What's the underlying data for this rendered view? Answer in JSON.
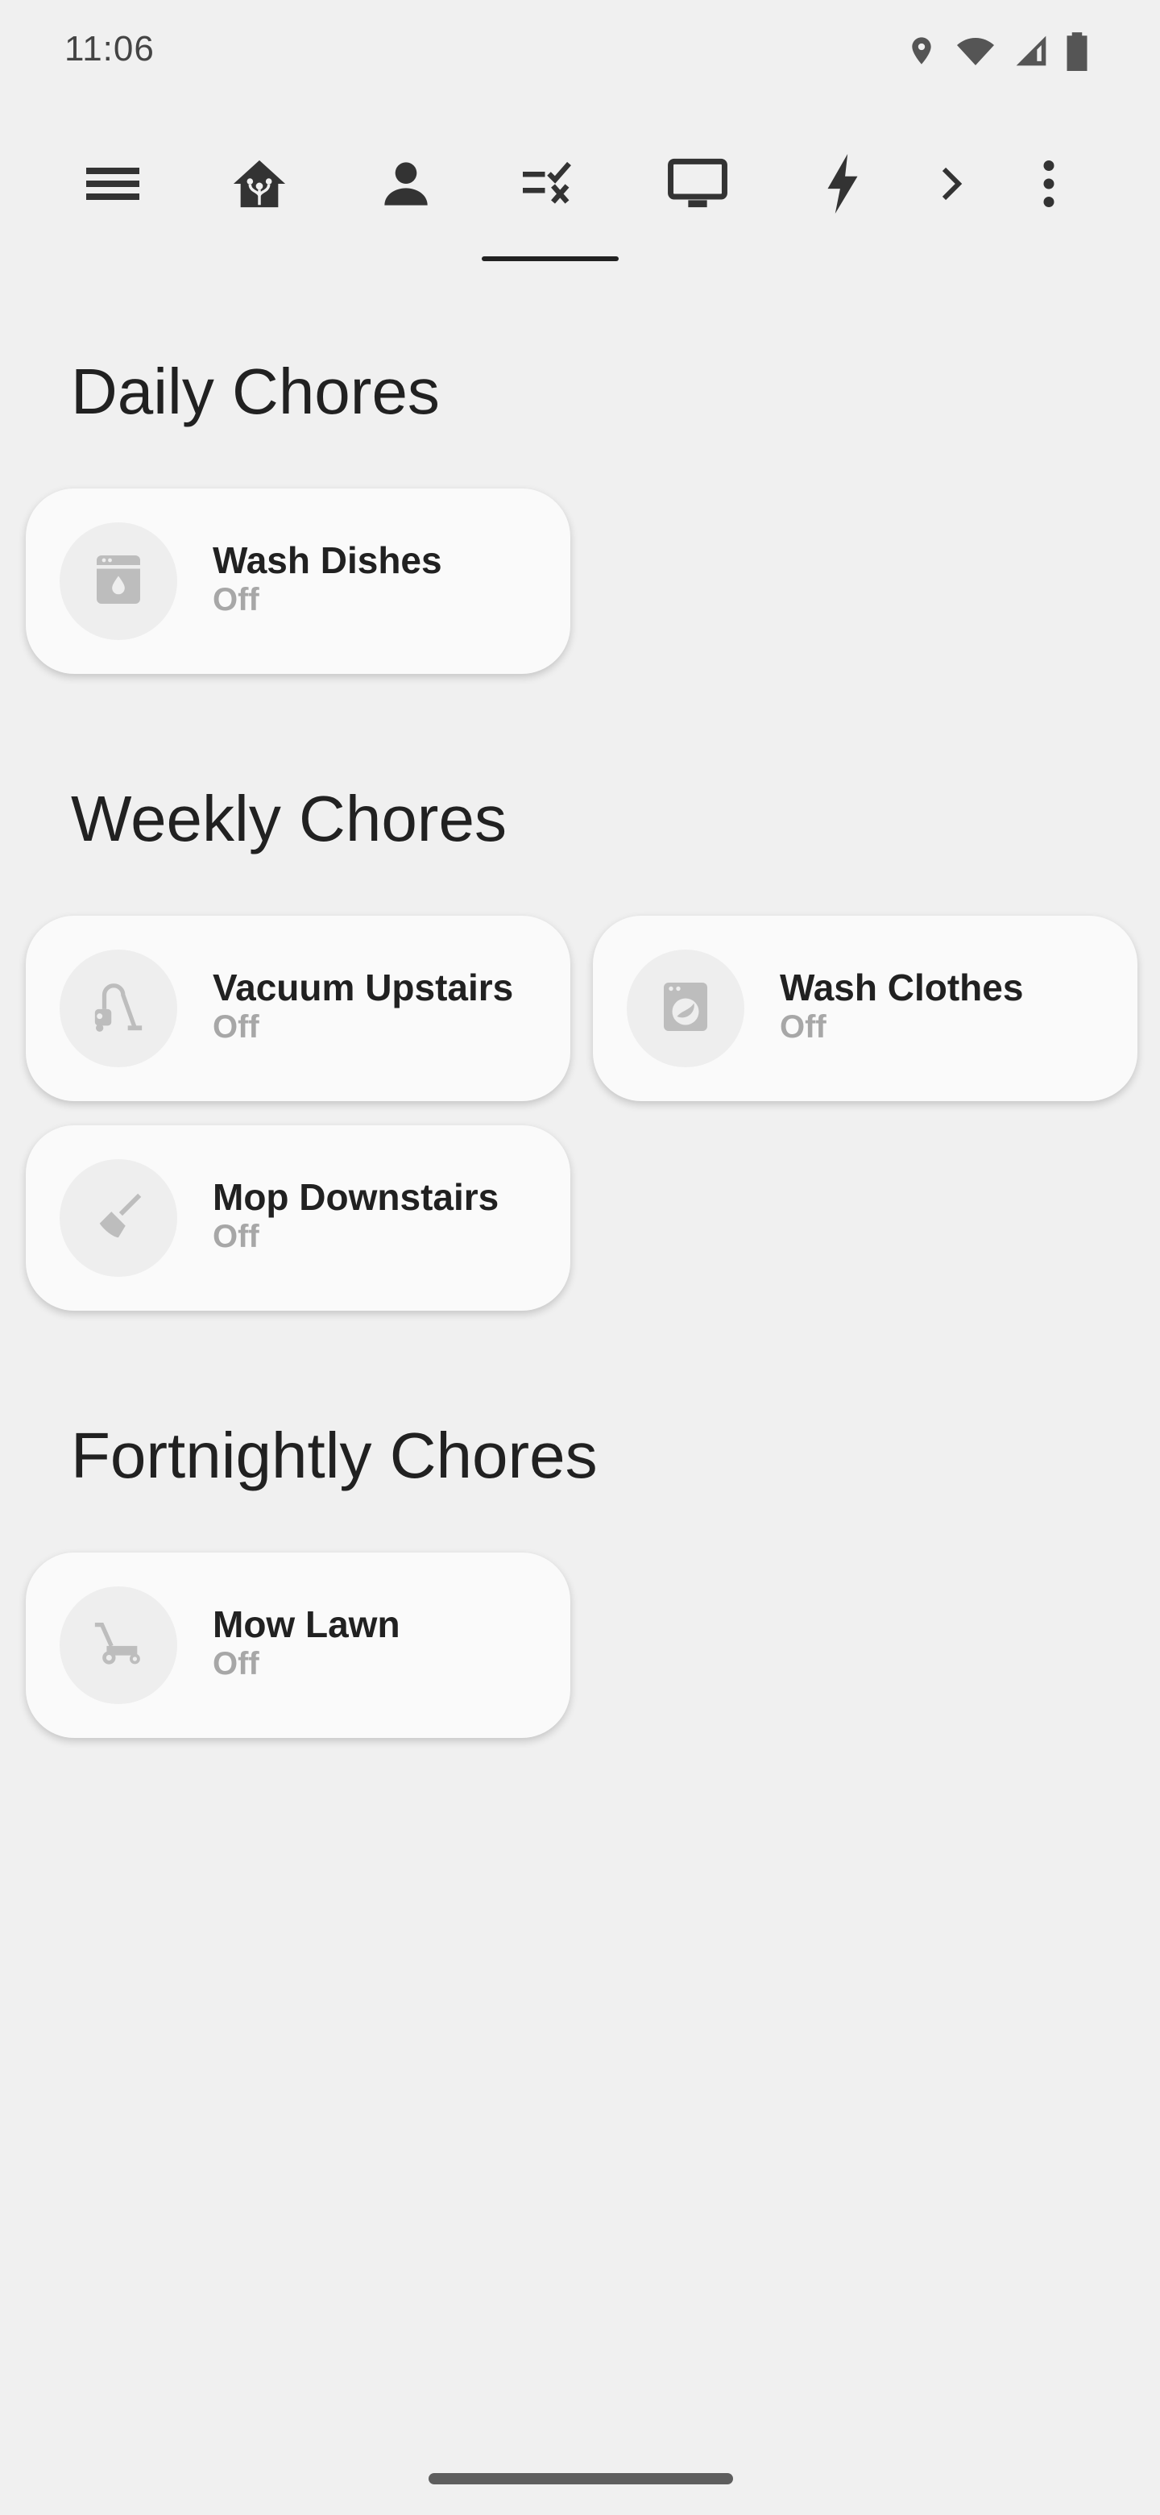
{
  "status_bar": {
    "time": "11:06",
    "icons": [
      "location-icon",
      "wifi-icon",
      "signal-icon",
      "battery-icon"
    ]
  },
  "toolbar": {
    "icons": [
      "menu-icon",
      "home-assistant-icon",
      "person-icon",
      "chores-icon",
      "tv-icon",
      "lightning-icon",
      "chevron-right-icon",
      "more-vert-icon"
    ],
    "active_tab": "chores-icon"
  },
  "sections": {
    "daily": {
      "title": "Daily Chores",
      "cards": [
        {
          "name": "Wash Dishes",
          "state": "Off",
          "icon": "dishwasher-icon"
        }
      ]
    },
    "weekly": {
      "title": "Weekly Chores",
      "cards": [
        {
          "name": "Vacuum Upstairs",
          "state": "Off",
          "icon": "vacuum-icon"
        },
        {
          "name": "Wash Clothes",
          "state": "Off",
          "icon": "washing-machine-icon"
        },
        {
          "name": "Mop Downstairs",
          "state": "Off",
          "icon": "broom-icon"
        }
      ]
    },
    "fortnightly": {
      "title": "Fortnightly Chores",
      "cards": [
        {
          "name": "Mow Lawn",
          "state": "Off",
          "icon": "lawn-mower-icon"
        }
      ]
    }
  },
  "colors": {
    "background": "#f0f0f0",
    "card": "#fafafa",
    "icon_circle": "#eeeeee",
    "icon_inactive": "#bdbdbd",
    "state_text": "#a7a7a7",
    "toolbar_icon": "#424242"
  }
}
